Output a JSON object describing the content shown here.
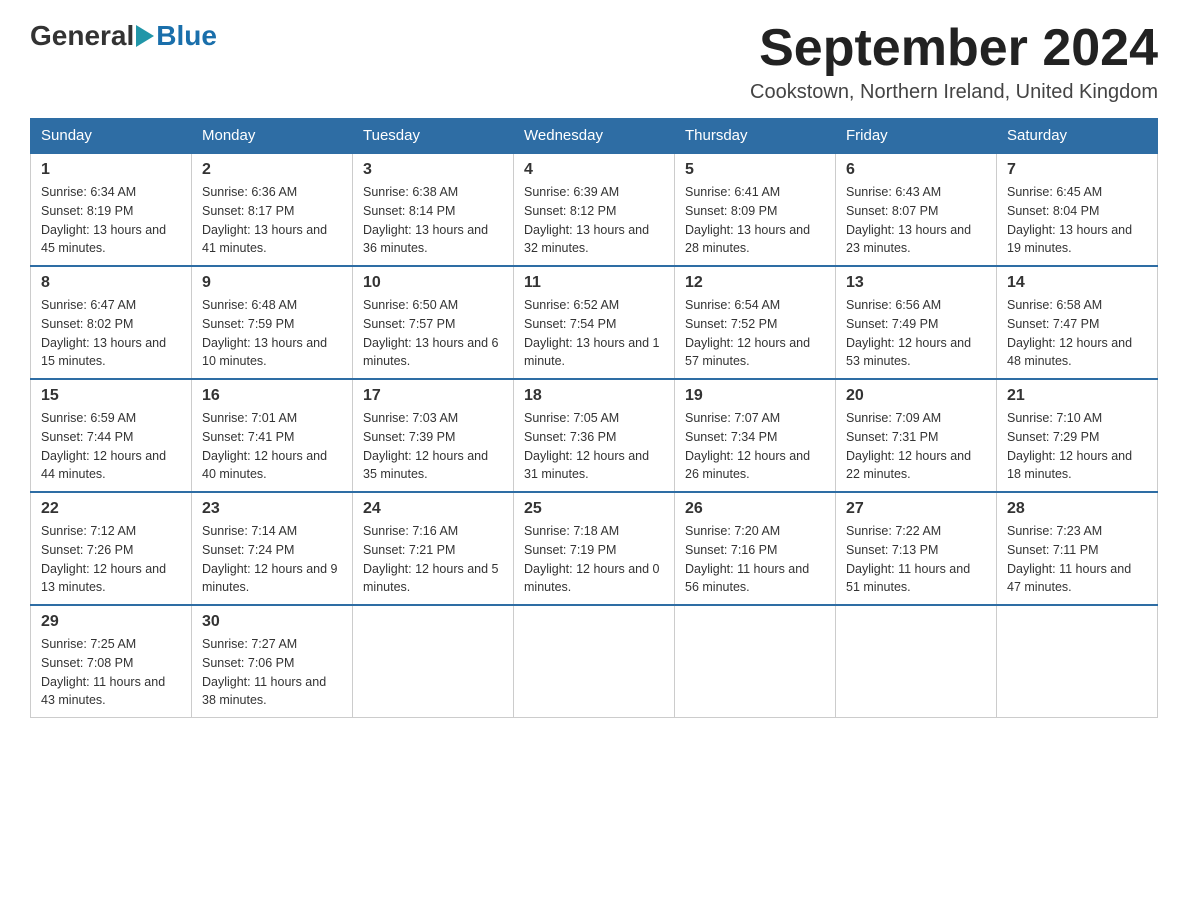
{
  "header": {
    "logo_general": "General",
    "logo_blue": "Blue",
    "month_title": "September 2024",
    "location": "Cookstown, Northern Ireland, United Kingdom"
  },
  "days_of_week": [
    "Sunday",
    "Monday",
    "Tuesday",
    "Wednesday",
    "Thursday",
    "Friday",
    "Saturday"
  ],
  "weeks": [
    [
      {
        "day": "1",
        "sunrise": "6:34 AM",
        "sunset": "8:19 PM",
        "daylight": "13 hours and 45 minutes."
      },
      {
        "day": "2",
        "sunrise": "6:36 AM",
        "sunset": "8:17 PM",
        "daylight": "13 hours and 41 minutes."
      },
      {
        "day": "3",
        "sunrise": "6:38 AM",
        "sunset": "8:14 PM",
        "daylight": "13 hours and 36 minutes."
      },
      {
        "day": "4",
        "sunrise": "6:39 AM",
        "sunset": "8:12 PM",
        "daylight": "13 hours and 32 minutes."
      },
      {
        "day": "5",
        "sunrise": "6:41 AM",
        "sunset": "8:09 PM",
        "daylight": "13 hours and 28 minutes."
      },
      {
        "day": "6",
        "sunrise": "6:43 AM",
        "sunset": "8:07 PM",
        "daylight": "13 hours and 23 minutes."
      },
      {
        "day": "7",
        "sunrise": "6:45 AM",
        "sunset": "8:04 PM",
        "daylight": "13 hours and 19 minutes."
      }
    ],
    [
      {
        "day": "8",
        "sunrise": "6:47 AM",
        "sunset": "8:02 PM",
        "daylight": "13 hours and 15 minutes."
      },
      {
        "day": "9",
        "sunrise": "6:48 AM",
        "sunset": "7:59 PM",
        "daylight": "13 hours and 10 minutes."
      },
      {
        "day": "10",
        "sunrise": "6:50 AM",
        "sunset": "7:57 PM",
        "daylight": "13 hours and 6 minutes."
      },
      {
        "day": "11",
        "sunrise": "6:52 AM",
        "sunset": "7:54 PM",
        "daylight": "13 hours and 1 minute."
      },
      {
        "day": "12",
        "sunrise": "6:54 AM",
        "sunset": "7:52 PM",
        "daylight": "12 hours and 57 minutes."
      },
      {
        "day": "13",
        "sunrise": "6:56 AM",
        "sunset": "7:49 PM",
        "daylight": "12 hours and 53 minutes."
      },
      {
        "day": "14",
        "sunrise": "6:58 AM",
        "sunset": "7:47 PM",
        "daylight": "12 hours and 48 minutes."
      }
    ],
    [
      {
        "day": "15",
        "sunrise": "6:59 AM",
        "sunset": "7:44 PM",
        "daylight": "12 hours and 44 minutes."
      },
      {
        "day": "16",
        "sunrise": "7:01 AM",
        "sunset": "7:41 PM",
        "daylight": "12 hours and 40 minutes."
      },
      {
        "day": "17",
        "sunrise": "7:03 AM",
        "sunset": "7:39 PM",
        "daylight": "12 hours and 35 minutes."
      },
      {
        "day": "18",
        "sunrise": "7:05 AM",
        "sunset": "7:36 PM",
        "daylight": "12 hours and 31 minutes."
      },
      {
        "day": "19",
        "sunrise": "7:07 AM",
        "sunset": "7:34 PM",
        "daylight": "12 hours and 26 minutes."
      },
      {
        "day": "20",
        "sunrise": "7:09 AM",
        "sunset": "7:31 PM",
        "daylight": "12 hours and 22 minutes."
      },
      {
        "day": "21",
        "sunrise": "7:10 AM",
        "sunset": "7:29 PM",
        "daylight": "12 hours and 18 minutes."
      }
    ],
    [
      {
        "day": "22",
        "sunrise": "7:12 AM",
        "sunset": "7:26 PM",
        "daylight": "12 hours and 13 minutes."
      },
      {
        "day": "23",
        "sunrise": "7:14 AM",
        "sunset": "7:24 PM",
        "daylight": "12 hours and 9 minutes."
      },
      {
        "day": "24",
        "sunrise": "7:16 AM",
        "sunset": "7:21 PM",
        "daylight": "12 hours and 5 minutes."
      },
      {
        "day": "25",
        "sunrise": "7:18 AM",
        "sunset": "7:19 PM",
        "daylight": "12 hours and 0 minutes."
      },
      {
        "day": "26",
        "sunrise": "7:20 AM",
        "sunset": "7:16 PM",
        "daylight": "11 hours and 56 minutes."
      },
      {
        "day": "27",
        "sunrise": "7:22 AM",
        "sunset": "7:13 PM",
        "daylight": "11 hours and 51 minutes."
      },
      {
        "day": "28",
        "sunrise": "7:23 AM",
        "sunset": "7:11 PM",
        "daylight": "11 hours and 47 minutes."
      }
    ],
    [
      {
        "day": "29",
        "sunrise": "7:25 AM",
        "sunset": "7:08 PM",
        "daylight": "11 hours and 43 minutes."
      },
      {
        "day": "30",
        "sunrise": "7:27 AM",
        "sunset": "7:06 PM",
        "daylight": "11 hours and 38 minutes."
      },
      null,
      null,
      null,
      null,
      null
    ]
  ]
}
